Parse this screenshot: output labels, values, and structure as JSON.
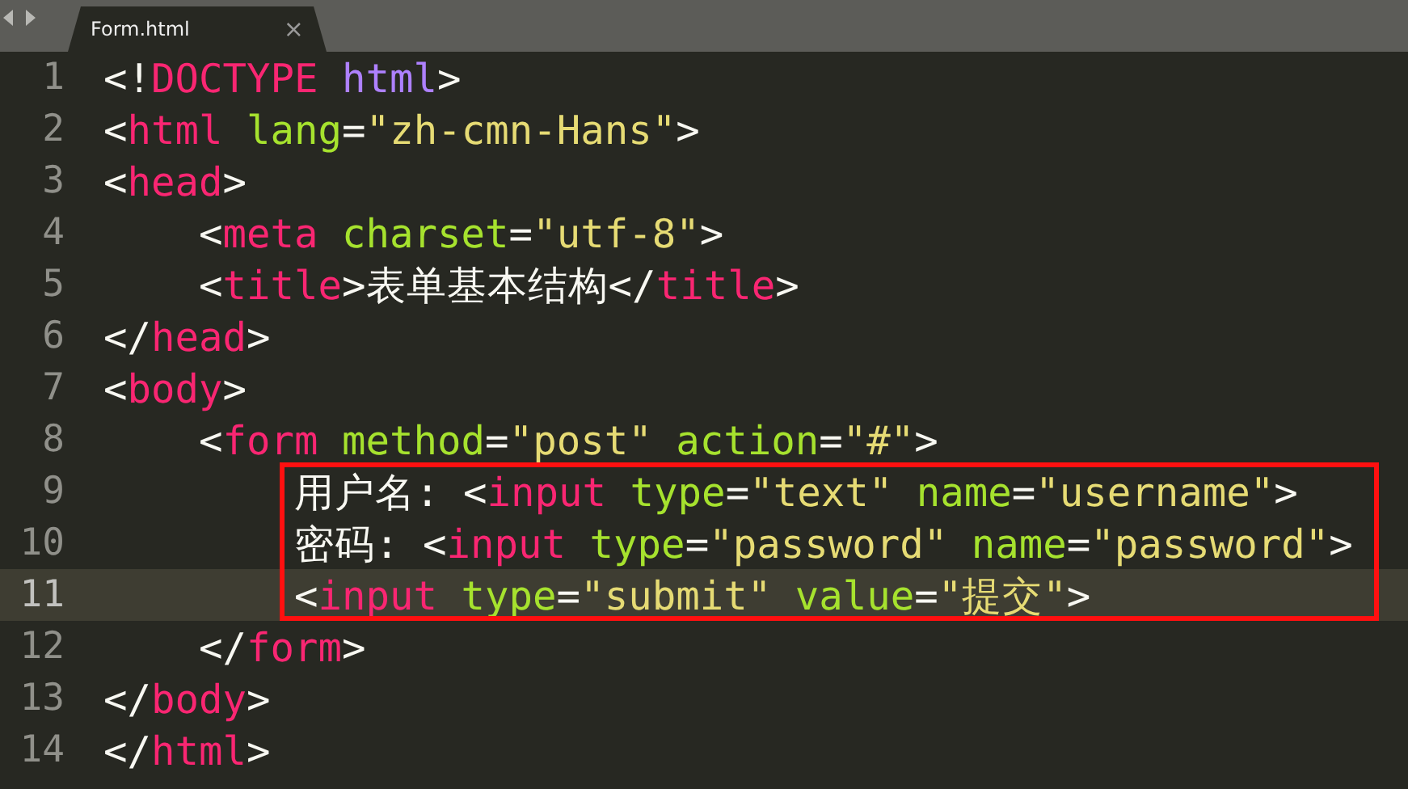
{
  "tab": {
    "title": "Form.html",
    "close": "×"
  },
  "lines": [
    {
      "number": "1",
      "current": false,
      "boxed": false,
      "tokens": [
        {
          "kind": "punct",
          "text": "<!"
        },
        {
          "kind": "tag",
          "text": "DOCTYPE"
        },
        {
          "kind": "keyword",
          "text": " html"
        },
        {
          "kind": "punct",
          "text": ">"
        }
      ]
    },
    {
      "number": "2",
      "current": false,
      "boxed": false,
      "tokens": [
        {
          "kind": "punct",
          "text": "<"
        },
        {
          "kind": "tag",
          "text": "html"
        },
        {
          "kind": "attr",
          "text": " lang"
        },
        {
          "kind": "punct",
          "text": "="
        },
        {
          "kind": "string",
          "text": "\"zh-cmn-Hans\""
        },
        {
          "kind": "punct",
          "text": ">"
        }
      ]
    },
    {
      "number": "3",
      "current": false,
      "boxed": false,
      "tokens": [
        {
          "kind": "punct",
          "text": "<"
        },
        {
          "kind": "tag",
          "text": "head"
        },
        {
          "kind": "punct",
          "text": ">"
        }
      ]
    },
    {
      "number": "4",
      "current": false,
      "boxed": false,
      "tokens": [
        {
          "kind": "punct",
          "text": "    <"
        },
        {
          "kind": "tag",
          "text": "meta"
        },
        {
          "kind": "attr",
          "text": " charset"
        },
        {
          "kind": "punct",
          "text": "="
        },
        {
          "kind": "string",
          "text": "\"utf-8\""
        },
        {
          "kind": "punct",
          "text": ">"
        }
      ]
    },
    {
      "number": "5",
      "current": false,
      "boxed": false,
      "tokens": [
        {
          "kind": "punct",
          "text": "    <"
        },
        {
          "kind": "tag",
          "text": "title"
        },
        {
          "kind": "punct",
          "text": ">"
        },
        {
          "kind": "text",
          "text": "表单基本结构"
        },
        {
          "kind": "punct",
          "text": "</"
        },
        {
          "kind": "tag",
          "text": "title"
        },
        {
          "kind": "punct",
          "text": ">"
        }
      ]
    },
    {
      "number": "6",
      "current": false,
      "boxed": false,
      "tokens": [
        {
          "kind": "punct",
          "text": "</"
        },
        {
          "kind": "tag",
          "text": "head"
        },
        {
          "kind": "punct",
          "text": ">"
        }
      ]
    },
    {
      "number": "7",
      "current": false,
      "boxed": false,
      "tokens": [
        {
          "kind": "punct",
          "text": "<"
        },
        {
          "kind": "tag",
          "text": "body"
        },
        {
          "kind": "punct",
          "text": ">"
        }
      ]
    },
    {
      "number": "8",
      "current": false,
      "boxed": false,
      "tokens": [
        {
          "kind": "punct",
          "text": "    <"
        },
        {
          "kind": "tag",
          "text": "form"
        },
        {
          "kind": "attr",
          "text": " method"
        },
        {
          "kind": "punct",
          "text": "="
        },
        {
          "kind": "string",
          "text": "\"post\""
        },
        {
          "kind": "attr",
          "text": " action"
        },
        {
          "kind": "punct",
          "text": "="
        },
        {
          "kind": "string",
          "text": "\"#\""
        },
        {
          "kind": "punct",
          "text": ">"
        }
      ]
    },
    {
      "number": "9",
      "current": false,
      "boxed": true,
      "tokens": [
        {
          "kind": "text",
          "text": "        用户名: "
        },
        {
          "kind": "punct",
          "text": "<"
        },
        {
          "kind": "tag",
          "text": "input"
        },
        {
          "kind": "attr",
          "text": " type"
        },
        {
          "kind": "punct",
          "text": "="
        },
        {
          "kind": "string",
          "text": "\"text\""
        },
        {
          "kind": "attr",
          "text": " name"
        },
        {
          "kind": "punct",
          "text": "="
        },
        {
          "kind": "string",
          "text": "\"username\""
        },
        {
          "kind": "punct",
          "text": ">"
        }
      ]
    },
    {
      "number": "10",
      "current": false,
      "boxed": true,
      "tokens": [
        {
          "kind": "text",
          "text": "        密码: "
        },
        {
          "kind": "punct",
          "text": "<"
        },
        {
          "kind": "tag",
          "text": "input"
        },
        {
          "kind": "attr",
          "text": " type"
        },
        {
          "kind": "punct",
          "text": "="
        },
        {
          "kind": "string",
          "text": "\"password\""
        },
        {
          "kind": "attr",
          "text": " name"
        },
        {
          "kind": "punct",
          "text": "="
        },
        {
          "kind": "string",
          "text": "\"password\""
        },
        {
          "kind": "punct",
          "text": ">"
        }
      ]
    },
    {
      "number": "11",
      "current": true,
      "boxed": true,
      "tokens": [
        {
          "kind": "punct",
          "text": "        <"
        },
        {
          "kind": "tag",
          "text": "input"
        },
        {
          "kind": "attr",
          "text": " type"
        },
        {
          "kind": "punct",
          "text": "="
        },
        {
          "kind": "string",
          "text": "\"submit\""
        },
        {
          "kind": "attr",
          "text": " value"
        },
        {
          "kind": "punct",
          "text": "="
        },
        {
          "kind": "string",
          "text": "\"提交\""
        },
        {
          "kind": "punct",
          "text": ">"
        }
      ]
    },
    {
      "number": "12",
      "current": false,
      "boxed": false,
      "tokens": [
        {
          "kind": "punct",
          "text": "    </"
        },
        {
          "kind": "tag",
          "text": "form"
        },
        {
          "kind": "punct",
          "text": ">"
        }
      ]
    },
    {
      "number": "13",
      "current": false,
      "boxed": false,
      "tokens": [
        {
          "kind": "punct",
          "text": "</"
        },
        {
          "kind": "tag",
          "text": "body"
        },
        {
          "kind": "punct",
          "text": ">"
        }
      ]
    },
    {
      "number": "14",
      "current": false,
      "boxed": false,
      "tokens": [
        {
          "kind": "punct",
          "text": "</"
        },
        {
          "kind": "tag",
          "text": "html"
        },
        {
          "kind": "punct",
          "text": ">"
        }
      ]
    }
  ]
}
